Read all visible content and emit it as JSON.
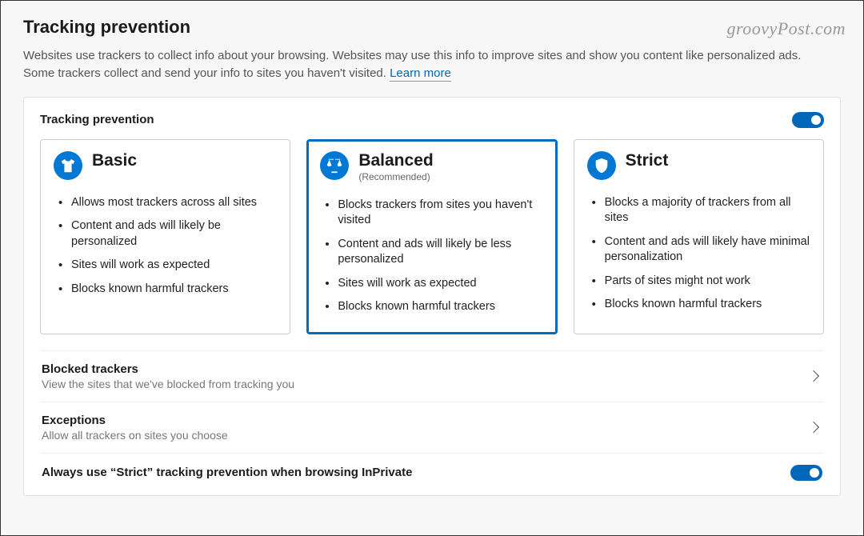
{
  "watermark": "groovyPost.com",
  "header": {
    "title": "Tracking prevention",
    "description": "Websites use trackers to collect info about your browsing. Websites may use this info to improve sites and show you content like personalized ads. Some trackers collect and send your info to sites you haven't visited. ",
    "learn_more": "Learn more"
  },
  "card": {
    "title": "Tracking prevention",
    "toggle_on": true
  },
  "options": [
    {
      "title": "Basic",
      "subtitle": "",
      "selected": false,
      "icon": "tshirt-icon",
      "bullets": [
        "Allows most trackers across all sites",
        "Content and ads will likely be personalized",
        "Sites will work as expected",
        "Blocks known harmful trackers"
      ]
    },
    {
      "title": "Balanced",
      "subtitle": "(Recommended)",
      "selected": true,
      "icon": "scales-icon",
      "bullets": [
        "Blocks trackers from sites you haven't visited",
        "Content and ads will likely be less personalized",
        "Sites will work as expected",
        "Blocks known harmful trackers"
      ]
    },
    {
      "title": "Strict",
      "subtitle": "",
      "selected": false,
      "icon": "shield-icon",
      "bullets": [
        "Blocks a majority of trackers from all sites",
        "Content and ads will likely have minimal personalization",
        "Parts of sites might not work",
        "Blocks known harmful trackers"
      ]
    }
  ],
  "rows": {
    "blocked": {
      "title": "Blocked trackers",
      "sub": "View the sites that we've blocked from tracking you"
    },
    "exceptions": {
      "title": "Exceptions",
      "sub": "Allow all trackers on sites you choose"
    },
    "inprivate": {
      "title": "Always use “Strict” tracking prevention when browsing InPrivate",
      "toggle_on": true
    }
  }
}
